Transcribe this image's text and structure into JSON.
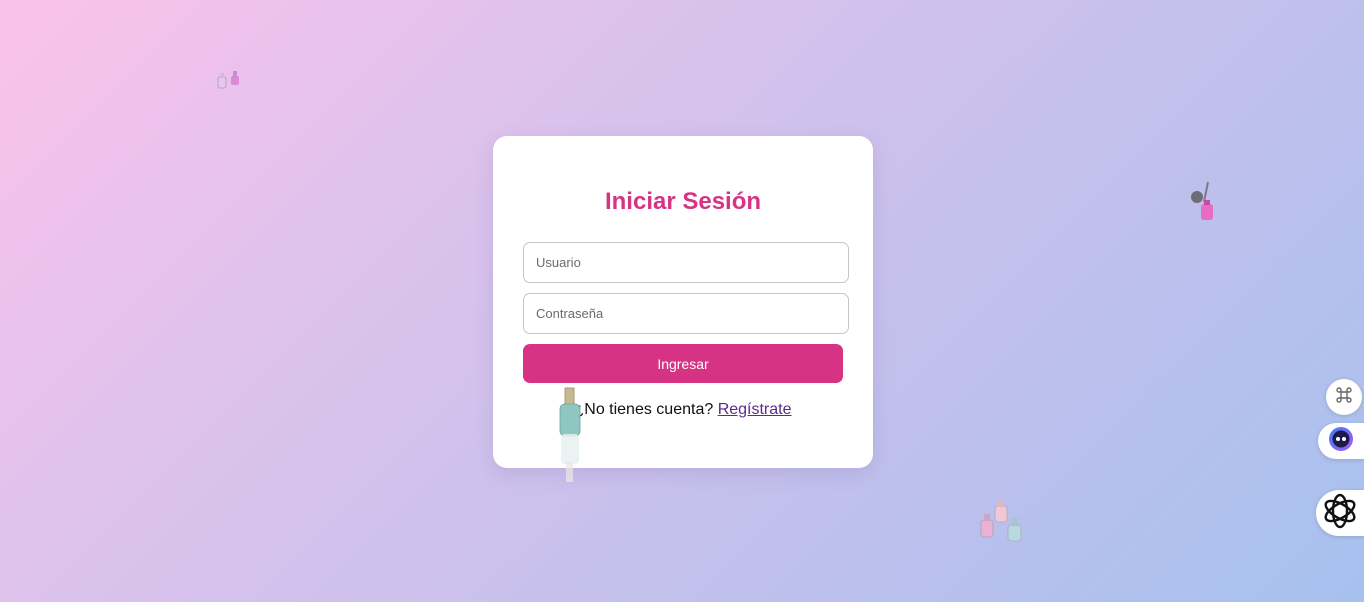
{
  "login": {
    "title": "Iniciar Sesión",
    "username_placeholder": "Usuario",
    "password_placeholder": "Contraseña",
    "submit_label": "Ingresar",
    "register_prompt": "¿No tienes cuenta?",
    "register_link": "Regístrate"
  },
  "colors": {
    "accent": "#d63384",
    "link": "#5a2a8c",
    "bg_start": "#fbc2eb",
    "bg_end": "#a6c1ee"
  },
  "decorations": [
    "nail-polish-small-icon",
    "nail-polish-brush-icon",
    "nail-polish-group-icon",
    "nail-polish-bottle-icon"
  ],
  "side_tools": [
    "command-icon",
    "assistant-face-icon",
    "openai-logo-icon"
  ]
}
